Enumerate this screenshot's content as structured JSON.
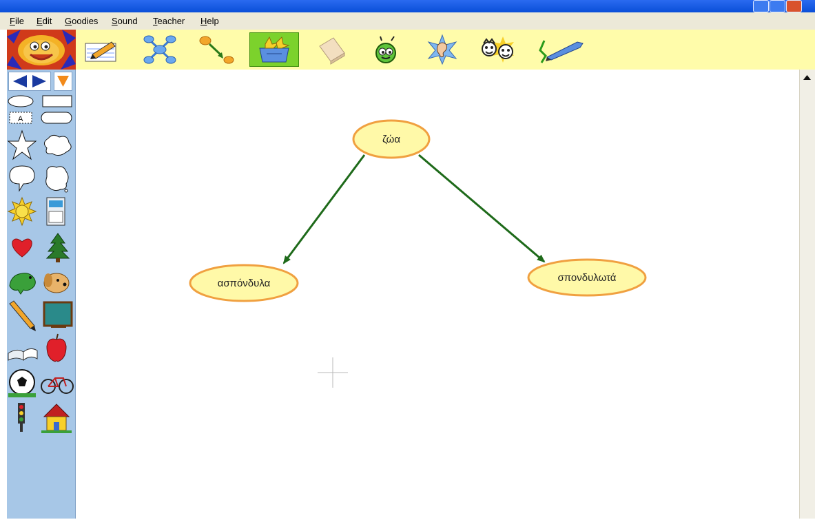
{
  "menu": {
    "file": "File",
    "edit": "Edit",
    "goodies": "Goodies",
    "sound": "Sound",
    "teacher": "Teacher",
    "help": "Help"
  },
  "toolbar": {
    "tools": [
      "write-tool",
      "mind-map-tool",
      "link-tool",
      "goodies-tool",
      "eraser-tool",
      "wacky-tool",
      "listen-tool",
      "faces-tool",
      "paint-tool"
    ],
    "selected": "goodies-tool"
  },
  "diagram": {
    "nodes": [
      {
        "id": "root",
        "label": "ζώα"
      },
      {
        "id": "left",
        "label": "ασπόνδυλα"
      },
      {
        "id": "right",
        "label": "σπονδυλωτά"
      }
    ],
    "edge_color": "#1e6a1a",
    "node_fill": "#fff9a8",
    "node_border": "#f0a040"
  },
  "colors": {
    "title_bar": "#0a4fd8",
    "menu_bar": "#ece9d8",
    "toolbar": "#fffcaa",
    "sidebar": "#a7c7e7"
  }
}
